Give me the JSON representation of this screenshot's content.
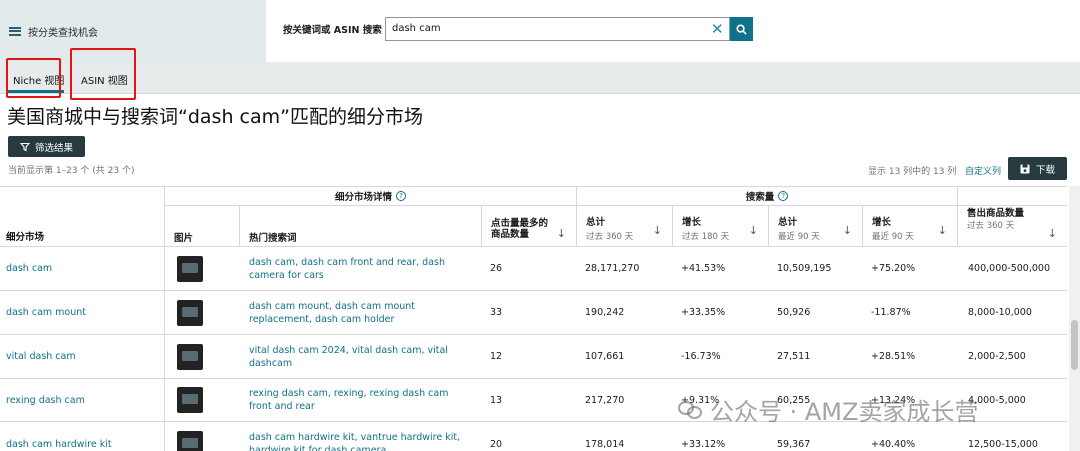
{
  "sidebar": {
    "label": "按分类查找机会"
  },
  "search": {
    "label": "按关键词或 ASIN 搜索",
    "value": "dash cam"
  },
  "tabs": [
    {
      "label": "Niche 视图"
    },
    {
      "label": "ASIN 视图"
    }
  ],
  "page_title": "美国商城中与搜索词“dash cam”匹配的细分市场",
  "filter_button": "筛选结果",
  "showing_text": "当前显示第 1–23 个 (共 23 个)",
  "columns_info": "显示 13 列中的 13 列",
  "custom_columns": "自定义列",
  "download_button": "下载",
  "table": {
    "group_headers": {
      "niche_details": "细分市场详情",
      "search_volume": "搜索量"
    },
    "headers": {
      "market": "细分市场",
      "image": "图片",
      "top_terms": "热门搜索词",
      "clicked_products": "点击量最多的商品数量",
      "sv_total": "总计",
      "sv_total_sub": "过去 360 天",
      "sv_growth": "增长",
      "sv_growth_sub": "过去 180 天",
      "sv_total90": "总计",
      "sv_total90_sub": "最近 90 天",
      "sv_growth90": "增长",
      "sv_growth90_sub": "最近 90 天",
      "units_sold": "售出商品数量",
      "units_sold_sub": "过去 360 天"
    },
    "rows": [
      {
        "market": "dash cam",
        "terms": "dash cam, dash cam front and rear, dash camera for cars",
        "count": "26",
        "total360": "28,171,270",
        "growth180": "+41.53%",
        "total90": "10,509,195",
        "growth90": "+75.20%",
        "units": "400,000-500,000"
      },
      {
        "market": "dash cam mount",
        "terms": "dash cam mount, dash cam mount replacement, dash cam holder",
        "count": "33",
        "total360": "190,242",
        "growth180": "+33.35%",
        "total90": "50,926",
        "growth90": "-11.87%",
        "units": "8,000-10,000"
      },
      {
        "market": "vital dash cam",
        "terms": "vital dash cam 2024, vital dash cam, vital dashcam",
        "count": "12",
        "total360": "107,661",
        "growth180": "-16.73%",
        "total90": "27,511",
        "growth90": "+28.51%",
        "units": "2,000-2,500"
      },
      {
        "market": "rexing dash cam",
        "terms": "rexing dash cam, rexing, rexing dash cam front and rear",
        "count": "13",
        "total360": "217,270",
        "growth180": "+9.31%",
        "total90": "60,255",
        "growth90": "+13.24%",
        "units": "4,000-5,000"
      },
      {
        "market": "dash cam hardwire kit",
        "terms": "dash cam hardwire kit, vantrue hardwire kit, hardwire kit for dash camera",
        "count": "20",
        "total360": "178,014",
        "growth180": "+33.12%",
        "total90": "59,367",
        "growth90": "+40.40%",
        "units": "12,500-15,000"
      }
    ]
  },
  "watermark": "公众号 · AMZ卖家成长营",
  "colors": {
    "accent": "#0f7289",
    "dark_button": "#263a40",
    "highlight_box": "#e01616"
  }
}
